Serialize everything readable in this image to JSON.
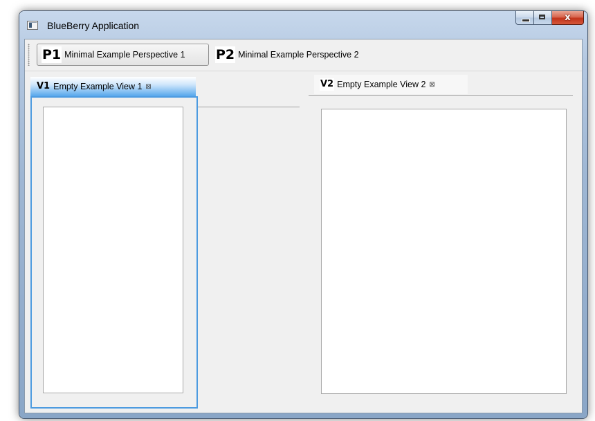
{
  "window": {
    "title": "BlueBerry Application",
    "controls": {
      "minimize": "minimize",
      "maximize": "maximize",
      "close": "x"
    }
  },
  "perspectives": [
    {
      "icon": "P1",
      "label": "Minimal Example Perspective 1",
      "active": true
    },
    {
      "icon": "P2",
      "label": "Minimal Example Perspective 2",
      "active": false
    }
  ],
  "views": [
    {
      "icon": "V1",
      "label": "Empty Example View 1",
      "close_glyph": "⊠",
      "active": true
    },
    {
      "icon": "V2",
      "label": "Empty Example View 2",
      "close_glyph": "⊠",
      "active": false
    }
  ],
  "colors": {
    "active_view_border": "#4d9be0",
    "client_background": "#f0f0f0",
    "close_button": "#c2341b"
  }
}
